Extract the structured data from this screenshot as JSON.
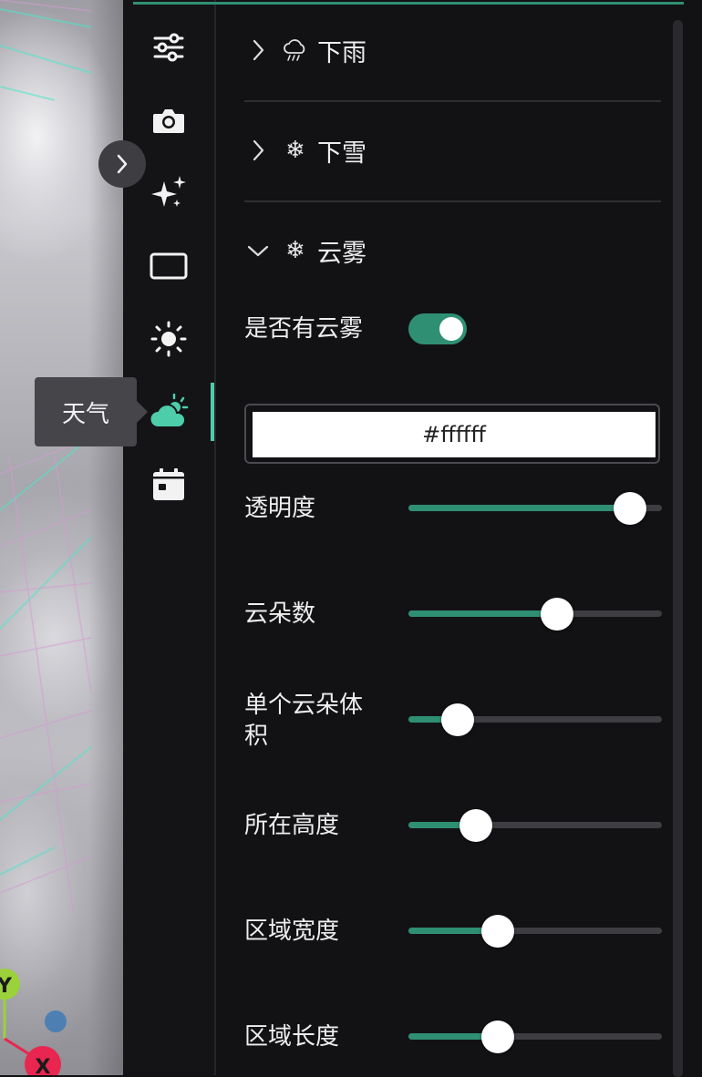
{
  "viewport": {
    "axis_y_label": "Y",
    "axis_x_label": "X",
    "colors": {
      "axis_y": "#9bd13a",
      "axis_x": "#e8264f",
      "axis_z": "#3a78b8",
      "grid_cyan": "#4ee6c8",
      "grid_pink": "#d69ad3"
    }
  },
  "tooltip": {
    "text": "天气"
  },
  "rail": {
    "items": [
      {
        "icon": "sliders-icon"
      },
      {
        "icon": "camera-icon"
      },
      {
        "icon": "sparkles-icon"
      },
      {
        "icon": "rectangle-icon"
      },
      {
        "icon": "sun-icon"
      },
      {
        "icon": "weather-icon",
        "active": true
      },
      {
        "icon": "calendar-icon"
      }
    ],
    "accent": "#4ecdab"
  },
  "sections": {
    "rain": {
      "label": "下雨",
      "icon": "cloud-rain-icon",
      "expanded": false
    },
    "snow": {
      "label": "下雪",
      "icon": "snowflake-icon",
      "expanded": false
    },
    "fog": {
      "label": "云雾",
      "icon": "snowflake-icon",
      "expanded": true
    }
  },
  "fog": {
    "toggle_label": "是否有云雾",
    "toggle_on": true,
    "color_value": "#ffffff",
    "sliders": [
      {
        "label": "透明度",
        "value": 0.93
      },
      {
        "label": "云朵数",
        "value": 0.6
      },
      {
        "label": "单个云朵体积",
        "value": 0.15
      },
      {
        "label": "所在高度",
        "value": 0.23
      },
      {
        "label": "区域宽度",
        "value": 0.33
      },
      {
        "label": "区域长度",
        "value": 0.33
      }
    ]
  },
  "colors": {
    "accent": "#2f8f72",
    "track": "#3d3d42",
    "panel_bg": "#121215"
  }
}
